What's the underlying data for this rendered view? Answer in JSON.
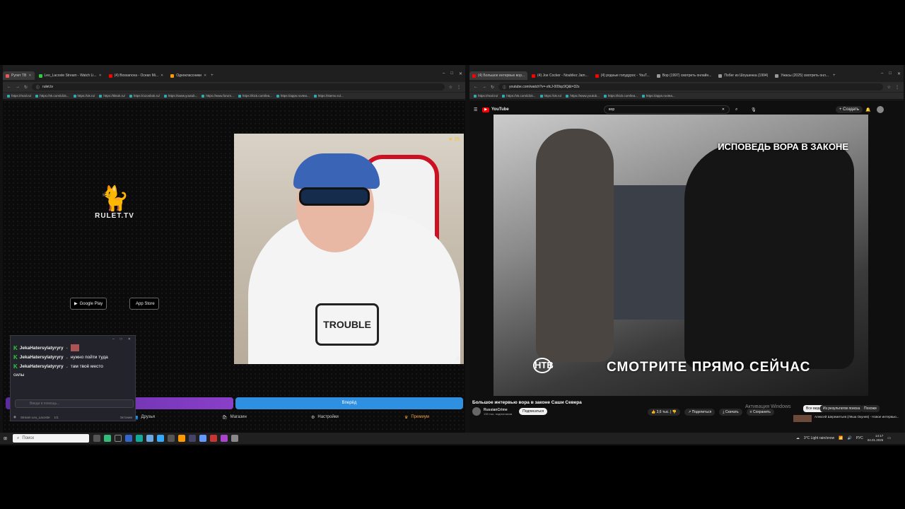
{
  "left": {
    "tabs": [
      {
        "label": "Рулет ТВ",
        "color": "#e55"
      },
      {
        "label": "Leo_Lacoste Stream - Watch Li...",
        "color": "#2ecc40"
      },
      {
        "label": "(4) Bossanova - Ocean Mi...",
        "color": "#f00"
      },
      {
        "label": "Одноклассники",
        "color": "#f90"
      }
    ],
    "url": "rulet.tv",
    "bookmarks": [
      "https://mail.ru/",
      "https://vk.com/id15...",
      "https://ok.ru/",
      "https://tiktok.ru/",
      "https://ozonbok.ru/",
      "https://www.youtub...",
      "https://www.forum...",
      "https://kick.com/lea...",
      "https://apps.ruvtea...",
      "https://stemo.ru/..."
    ],
    "brand": "RULET.TV",
    "google_play": "Google Play",
    "google_play_sub": "GET IT ON",
    "app_store": "App Store",
    "app_store_sub": "Download on the",
    "star_count": "25",
    "start_button": "Вперёд",
    "nav": [
      "Друзья",
      "Магазин",
      "Настройки",
      "Премиум"
    ]
  },
  "chat": {
    "messages": [
      {
        "nick": "JekaHatersylatyryry",
        "text": ""
      },
      {
        "nick": "JekaHatersylatyryry",
        "text": "нужно пойти туда"
      },
      {
        "nick": "JekaHatersylatyryry",
        "text": "там твоё место"
      }
    ],
    "continuation": "силы",
    "placeholder": "Введи в помощь...",
    "footer_user": "Stream Leo_Lacoste",
    "footer_count": "1/1",
    "footer_status": "Эстония"
  },
  "right": {
    "tabs": [
      {
        "label": "(4) Большое интервью вор...",
        "color": "#f00"
      },
      {
        "label": "(4) Joe Cocker - Noubliez Jam...",
        "color": "#f00"
      },
      {
        "label": "(4) родные голудурос - YouT...",
        "color": "#f00"
      },
      {
        "label": "Вор (1997) смотреть онлайн...",
        "color": "#999"
      },
      {
        "label": "Побег из Шоушенка (1994)",
        "color": "#999"
      },
      {
        "label": "Ужасы (2025) смотреть онл...",
        "color": "#999"
      }
    ],
    "url": "youtube.com/watch?v=-sfcJ-009qc9Q&t=32s",
    "search": "вор",
    "create_label": "Создать",
    "video_caption_top": "ИСПОВЕДЬ ВОРА В ЗАКОНЕ",
    "video_caption_bottom": "СМОТРИТЕ ПРЯМО СЕЙЧАС",
    "channel_logo": "НТВ",
    "title": "Большое интервью вора в законе Саши Севера",
    "channel": "RussianCrime",
    "subscribers": "135 тыс. подписчиков",
    "subscribe": "Подписаться",
    "likes": "3,6 тыс.",
    "share": "Поделиться",
    "download": "Скачать",
    "save": "Сохранить",
    "activation": "Активация Windows",
    "filters": [
      "Все видео",
      "Из результатов поиска",
      "Похожи"
    ],
    "reco_title": "Алексей Шереметьев (Лёша Окунев) - Новое интервью..."
  },
  "taskbar": {
    "search_placeholder": "Поиск",
    "weather": "3°C  Light rain/snow",
    "lang": "РУС",
    "time": "14:17",
    "date": "04.01.2026"
  }
}
